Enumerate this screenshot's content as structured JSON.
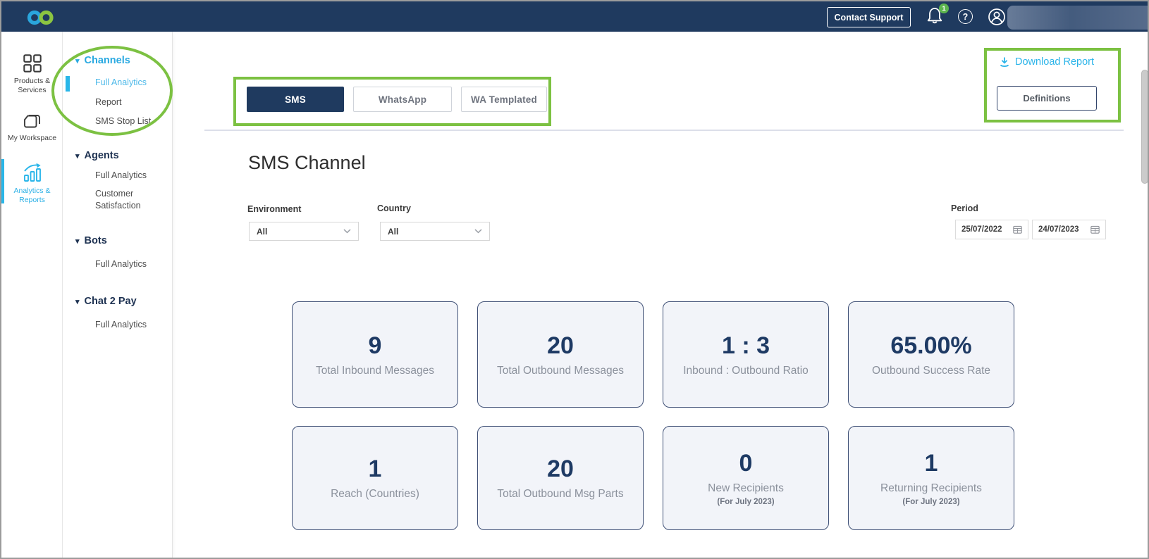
{
  "header": {
    "contact_support_label": "Contact Support",
    "notification_count": "1"
  },
  "icons": {
    "help_glyph": "?",
    "section_triangle": "▾"
  },
  "nav_rail": {
    "items": [
      {
        "label": "Products & Services",
        "icon": "grid-icon",
        "active": false
      },
      {
        "label": "My Workspace",
        "icon": "workspace-icon",
        "active": false
      },
      {
        "label": "Analytics & Reports",
        "icon": "analytics-icon",
        "active": true
      }
    ]
  },
  "sidebar": {
    "sections": [
      {
        "label": "Channels",
        "items": [
          "Full Analytics",
          "Report",
          "SMS Stop List"
        ],
        "active_item": "Full Analytics"
      },
      {
        "label": "Agents",
        "items": [
          "Full Analytics",
          "Customer Satisfaction"
        ]
      },
      {
        "label": "Bots",
        "items": [
          "Full Analytics"
        ]
      },
      {
        "label": "Chat 2 Pay",
        "items": [
          "Full Analytics"
        ]
      }
    ]
  },
  "tabs": [
    {
      "label": "SMS",
      "active": true
    },
    {
      "label": "WhatsApp",
      "active": false
    },
    {
      "label": "WA Templated",
      "active": false
    }
  ],
  "actions": {
    "download_report_label": "Download Report",
    "definitions_label": "Definitions"
  },
  "page": {
    "title": "SMS Channel"
  },
  "filters": {
    "environment": {
      "label": "Environment",
      "value": "All"
    },
    "country": {
      "label": "Country",
      "value": "All"
    },
    "period": {
      "label": "Period",
      "start_date": "25/07/2022",
      "end_date": "24/07/2023"
    }
  },
  "stats": [
    {
      "value": "9",
      "label": "Total Inbound Messages"
    },
    {
      "value": "20",
      "label": "Total Outbound Messages"
    },
    {
      "value": "1 : 3",
      "label": "Inbound : Outbound Ratio"
    },
    {
      "value": "65.00%",
      "label": "Outbound Success Rate"
    },
    {
      "value": "1",
      "label": "Reach (Countries)"
    },
    {
      "value": "20",
      "label": "Total Outbound Msg Parts"
    },
    {
      "value": "0",
      "label": "New Recipients",
      "sublabel": "(For July 2023)"
    },
    {
      "value": "1",
      "label": "Returning Recipients",
      "sublabel": "(For July 2023)"
    }
  ],
  "colors": {
    "brand_navy": "#1f3a5f",
    "accent_cyan": "#29abe2",
    "link_cyan": "#2bb4e9",
    "annotation_green": "#7cc142",
    "badge_green": "#5cb54e",
    "card_background": "#f2f4f9",
    "card_border": "#3f5076"
  }
}
